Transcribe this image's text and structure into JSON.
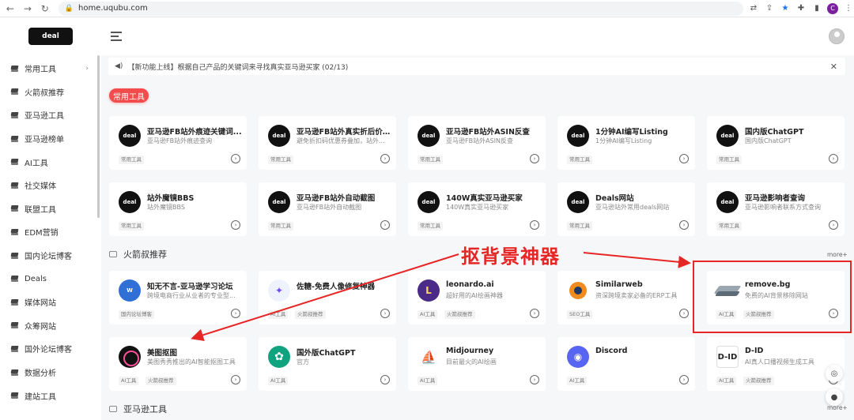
{
  "browser": {
    "url": "home.uqubu.com",
    "profile_initial": "C"
  },
  "header": {
    "logo_text": "deal"
  },
  "sidebar": {
    "items": [
      {
        "label": "常用工具",
        "chevron": "›"
      },
      {
        "label": "火箭叔推荐"
      },
      {
        "label": "亚马逊工具"
      },
      {
        "label": "亚马逊榜单"
      },
      {
        "label": "AI工具"
      },
      {
        "label": "社交媒体"
      },
      {
        "label": "联盟工具"
      },
      {
        "label": "EDM营销"
      },
      {
        "label": "国内论坛博客"
      },
      {
        "label": "Deals"
      },
      {
        "label": "媒体网站"
      },
      {
        "label": "众筹网站"
      },
      {
        "label": "国外论坛博客"
      },
      {
        "label": "数据分析"
      },
      {
        "label": "建站工具"
      }
    ]
  },
  "announcement": {
    "text": "【新功能上线】根据自己产品的关键词来寻找真实亚马逊买家 (02/13)",
    "close": "✕"
  },
  "common_tools": {
    "pill_label": "常用工具",
    "cards": [
      {
        "icon": "deal",
        "title": "亚马逊FB站外痕迹关键词...",
        "desc": "亚马逊FB站外痕迹查询",
        "tags": [
          "常用工具"
        ]
      },
      {
        "icon": "deal",
        "title": "亚马逊FB站外真实折后价测试",
        "desc": "避免折扣码优惠券叠加，站外...",
        "tags": [
          "常用工具"
        ]
      },
      {
        "icon": "deal",
        "title": "亚马逊FB站外ASIN反查",
        "desc": "亚马逊FB站外ASIN反查",
        "tags": [
          "常用工具"
        ]
      },
      {
        "icon": "deal",
        "title": "1分钟AI编写Listing",
        "desc": "1分钟AI编写Listing",
        "tags": [
          "常用工具"
        ]
      },
      {
        "icon": "deal",
        "title": "国内版ChatGPT",
        "desc": "国内版ChatGPT",
        "tags": [
          "常用工具"
        ]
      },
      {
        "icon": "deal",
        "title": "站外魔镜BBS",
        "desc": "站外魔镜BBS",
        "tags": [
          "常用工具"
        ]
      },
      {
        "icon": "deal",
        "title": "亚马逊FB站外自动截图",
        "desc": "亚马逊FB站外自动截图",
        "tags": [
          "常用工具"
        ]
      },
      {
        "icon": "deal",
        "title": "140W真实亚马逊买家",
        "desc": "140W真实亚马逊买家",
        "tags": [
          "常用工具"
        ]
      },
      {
        "icon": "deal",
        "title": "Deals网站",
        "desc": "亚马逊站外常用deals网站",
        "tags": [
          "常用工具"
        ]
      },
      {
        "icon": "deal",
        "title": "亚马逊影响者查询",
        "desc": "亚马逊影响者联系方式查询",
        "tags": [
          "常用工具"
        ]
      }
    ]
  },
  "recommend": {
    "title": "火箭叔推荐",
    "more": "more+",
    "cards": [
      {
        "icon": "wz",
        "glyph": "W",
        "title": "知无不言-亚马逊学习论坛",
        "desc": "跨境电商行业从业者的专业型...",
        "tags": [
          "国内论坛博客"
        ]
      },
      {
        "icon": "zs",
        "glyph": "✦",
        "title": "佐糖-免费人像修复神器",
        "desc": "",
        "tags": [
          "AI工具",
          "火箭叔推荐"
        ]
      },
      {
        "icon": "leo",
        "glyph": "L",
        "title": "leonardo.ai",
        "desc": "超好用的AI绘画神器",
        "tags": [
          "AI工具",
          "火箭叔推荐"
        ]
      },
      {
        "icon": "sw",
        "glyph": "",
        "title": "Similarweb",
        "desc": "资深跨境卖家必备的ERP工具",
        "tags": [
          "SEO工具"
        ]
      },
      {
        "icon": "rb",
        "glyph": "",
        "title": "remove.bg",
        "desc": "免费的AI背景移除网站",
        "tags": [
          "AI工具",
          "火箭叔推荐"
        ]
      },
      {
        "icon": "mt",
        "glyph": "",
        "title": "美图抠图",
        "desc": "美图秀秀推出的AI智能抠图工具",
        "tags": [
          "AI工具",
          "火箭叔推荐"
        ]
      },
      {
        "icon": "gpt",
        "glyph": "✿",
        "title": "国外版ChatGPT",
        "desc": "官方",
        "tags": [
          "AI工具"
        ]
      },
      {
        "icon": "mj",
        "glyph": "⛵",
        "title": "Midjourney",
        "desc": "目前最火的AI绘画",
        "tags": [
          "AI工具"
        ]
      },
      {
        "icon": "dc",
        "glyph": "◉",
        "title": "Discord",
        "desc": "",
        "tags": [
          "AI工具"
        ]
      },
      {
        "icon": "did",
        "glyph": "D-ID",
        "title": "D-ID",
        "desc": "AI真人口播视频生成工具",
        "tags": [
          "AI工具",
          "火箭叔推荐"
        ]
      }
    ]
  },
  "amazon_section": {
    "title": "亚马逊工具",
    "more": "more+"
  },
  "annotation": {
    "text": "抠背景神器",
    "color": "#e82525"
  },
  "colors": {
    "accent_red": "#f24c4c",
    "annotation_red": "#e82525",
    "page_bg": "#f6f7f9"
  }
}
